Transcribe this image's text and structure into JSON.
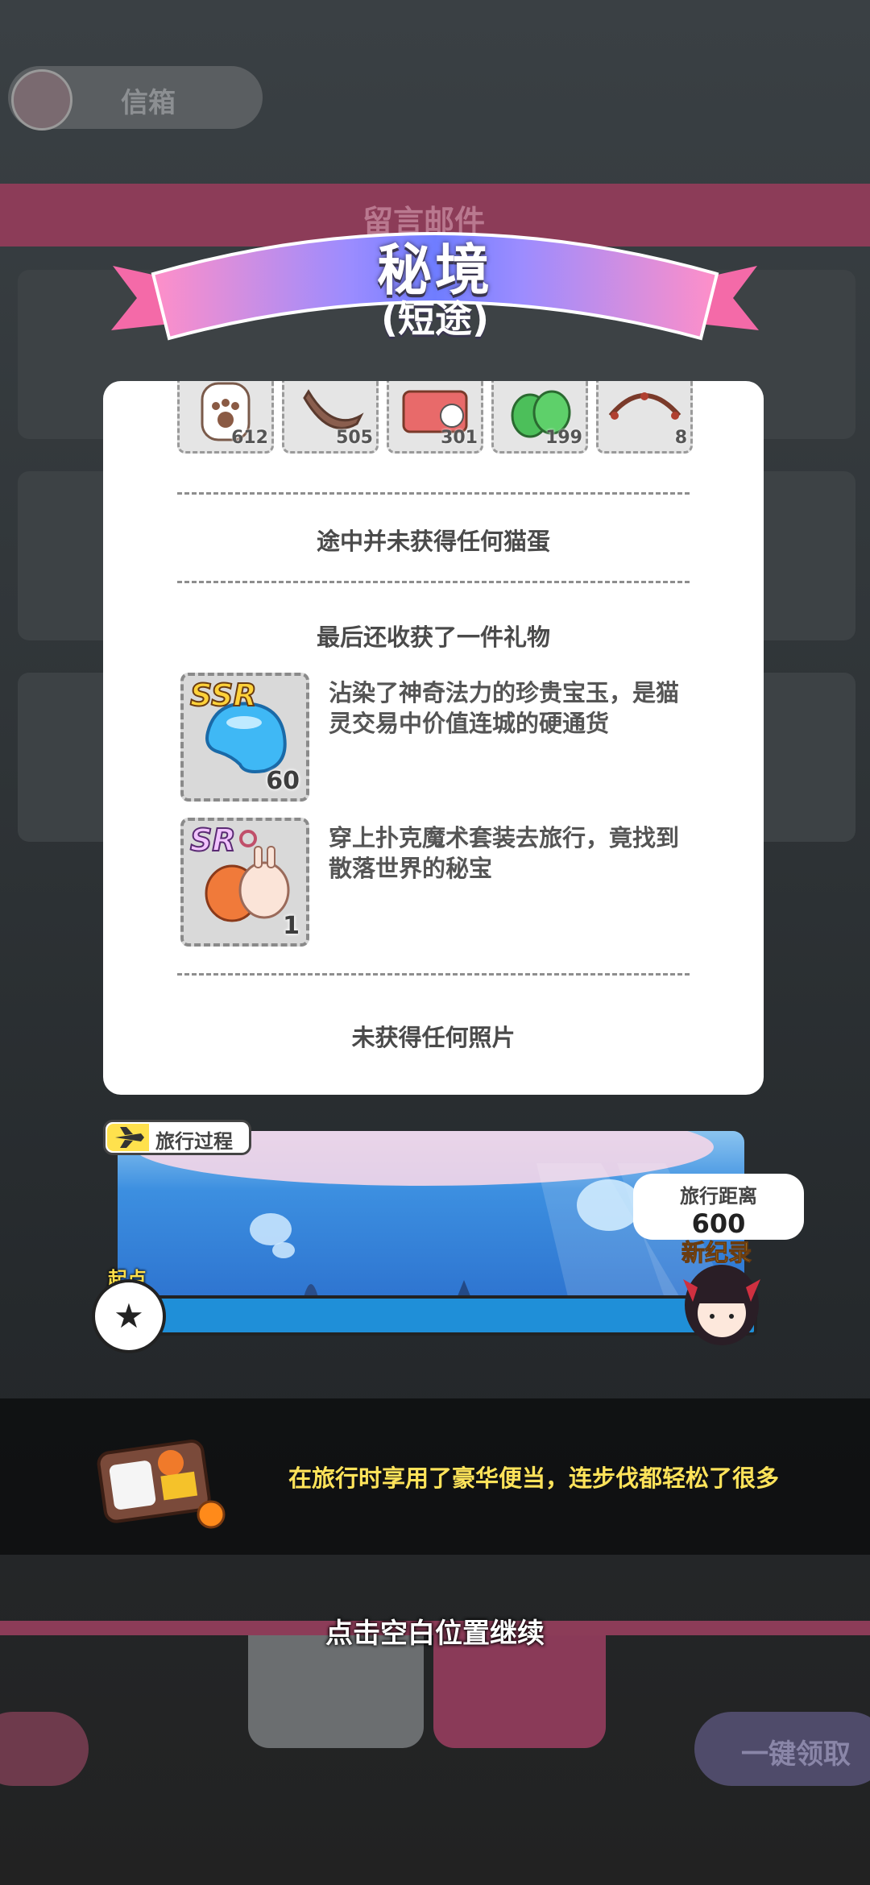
{
  "background": {
    "topbar_label": "信箱",
    "band_label": "留言邮件",
    "onekey_label": "一键领取"
  },
  "header": {
    "title": "秘境",
    "subtitle": "(短途)"
  },
  "items": [
    {
      "icon": "paw-item-icon",
      "count": "612"
    },
    {
      "icon": "fish-jerky-icon",
      "count": "505"
    },
    {
      "icon": "cat-can-icon",
      "count": "301"
    },
    {
      "icon": "catnip-leaf-icon",
      "count": "199"
    },
    {
      "icon": "net-basket-icon",
      "count": "8"
    }
  ],
  "sections": {
    "no_eggs": "途中并未获得任何猫蛋",
    "gift_header": "最后还收获了一件礼物",
    "no_photos": "未获得任何照片"
  },
  "gifts": [
    {
      "rarity": "SSR",
      "count": "60",
      "icon": "spirit-jade-icon",
      "description": "沾染了神奇法力的珍贵宝玉，是猫灵交易中价值连城的硬通货"
    },
    {
      "rarity": "SR",
      "count": "1",
      "icon": "fox-rabbit-charm-icon",
      "description": "穿上扑克魔术套装去旅行，竟找到散落世界的秘宝"
    }
  ],
  "travel": {
    "process_label": "旅行过程",
    "start_label": "起点",
    "distance_title": "旅行距离",
    "distance_value": "600",
    "record_label": "新纪录",
    "progress_fraction": 1.0
  },
  "food": {
    "message": "在旅行时享用了豪华便当，连步伐都轻松了很多"
  },
  "continue_hint": "点击空白位置继续",
  "colors": {
    "ribbon_pink": "#ff8fc8",
    "ribbon_blue": "#7f7cff",
    "accent_yellow": "#ffe35a",
    "track_blue": "#1f8fd8"
  }
}
